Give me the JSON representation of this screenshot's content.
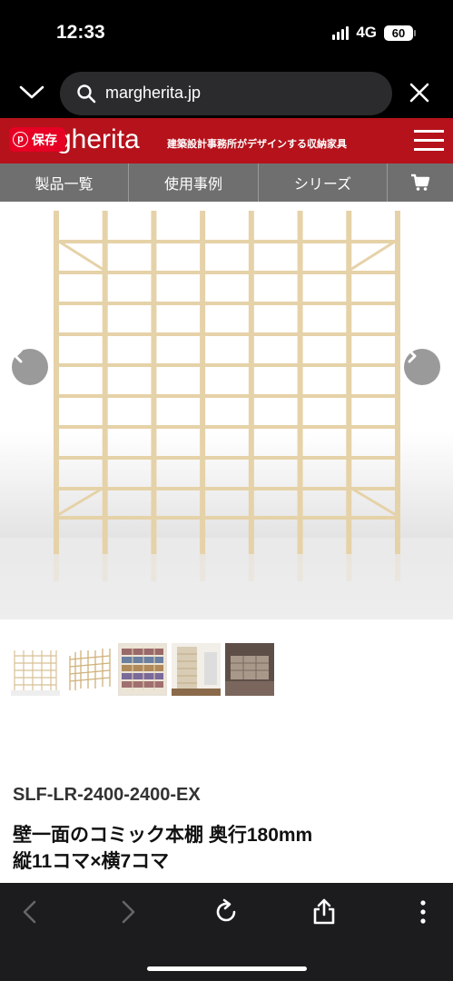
{
  "status_bar": {
    "time": "12:33",
    "network": "4G",
    "battery": "60"
  },
  "browser": {
    "url": "margherita.jp"
  },
  "site": {
    "logo_text": "gherita",
    "tagline": "建築設計事務所がデザインする収納家具",
    "pin_label": "保存",
    "pin_glyph": "p",
    "nav": [
      {
        "label": "製品一覧"
      },
      {
        "label": "使用事例"
      },
      {
        "label": "シリーズ"
      },
      {
        "label": ""
      }
    ]
  },
  "product": {
    "sku": "SLF-LR-2400-2400-EX",
    "title_line1": "壁一面のコミック本棚 奥行180mm",
    "title_line2": "縦11コマ×横7コマ",
    "thumbnail_count": 5
  },
  "colors": {
    "header_red": "#b5121b",
    "nav_gray": "#6f6f6f",
    "pinterest_red": "#e60023",
    "wood": "#e6d2a8"
  },
  "icons": [
    "chevron-down-icon",
    "search-icon",
    "close-icon",
    "pinterest-icon",
    "menu-icon",
    "cart-icon",
    "arrow-left-icon",
    "arrow-right-icon",
    "back-icon",
    "forward-icon",
    "reload-icon",
    "share-icon",
    "more-icon"
  ]
}
